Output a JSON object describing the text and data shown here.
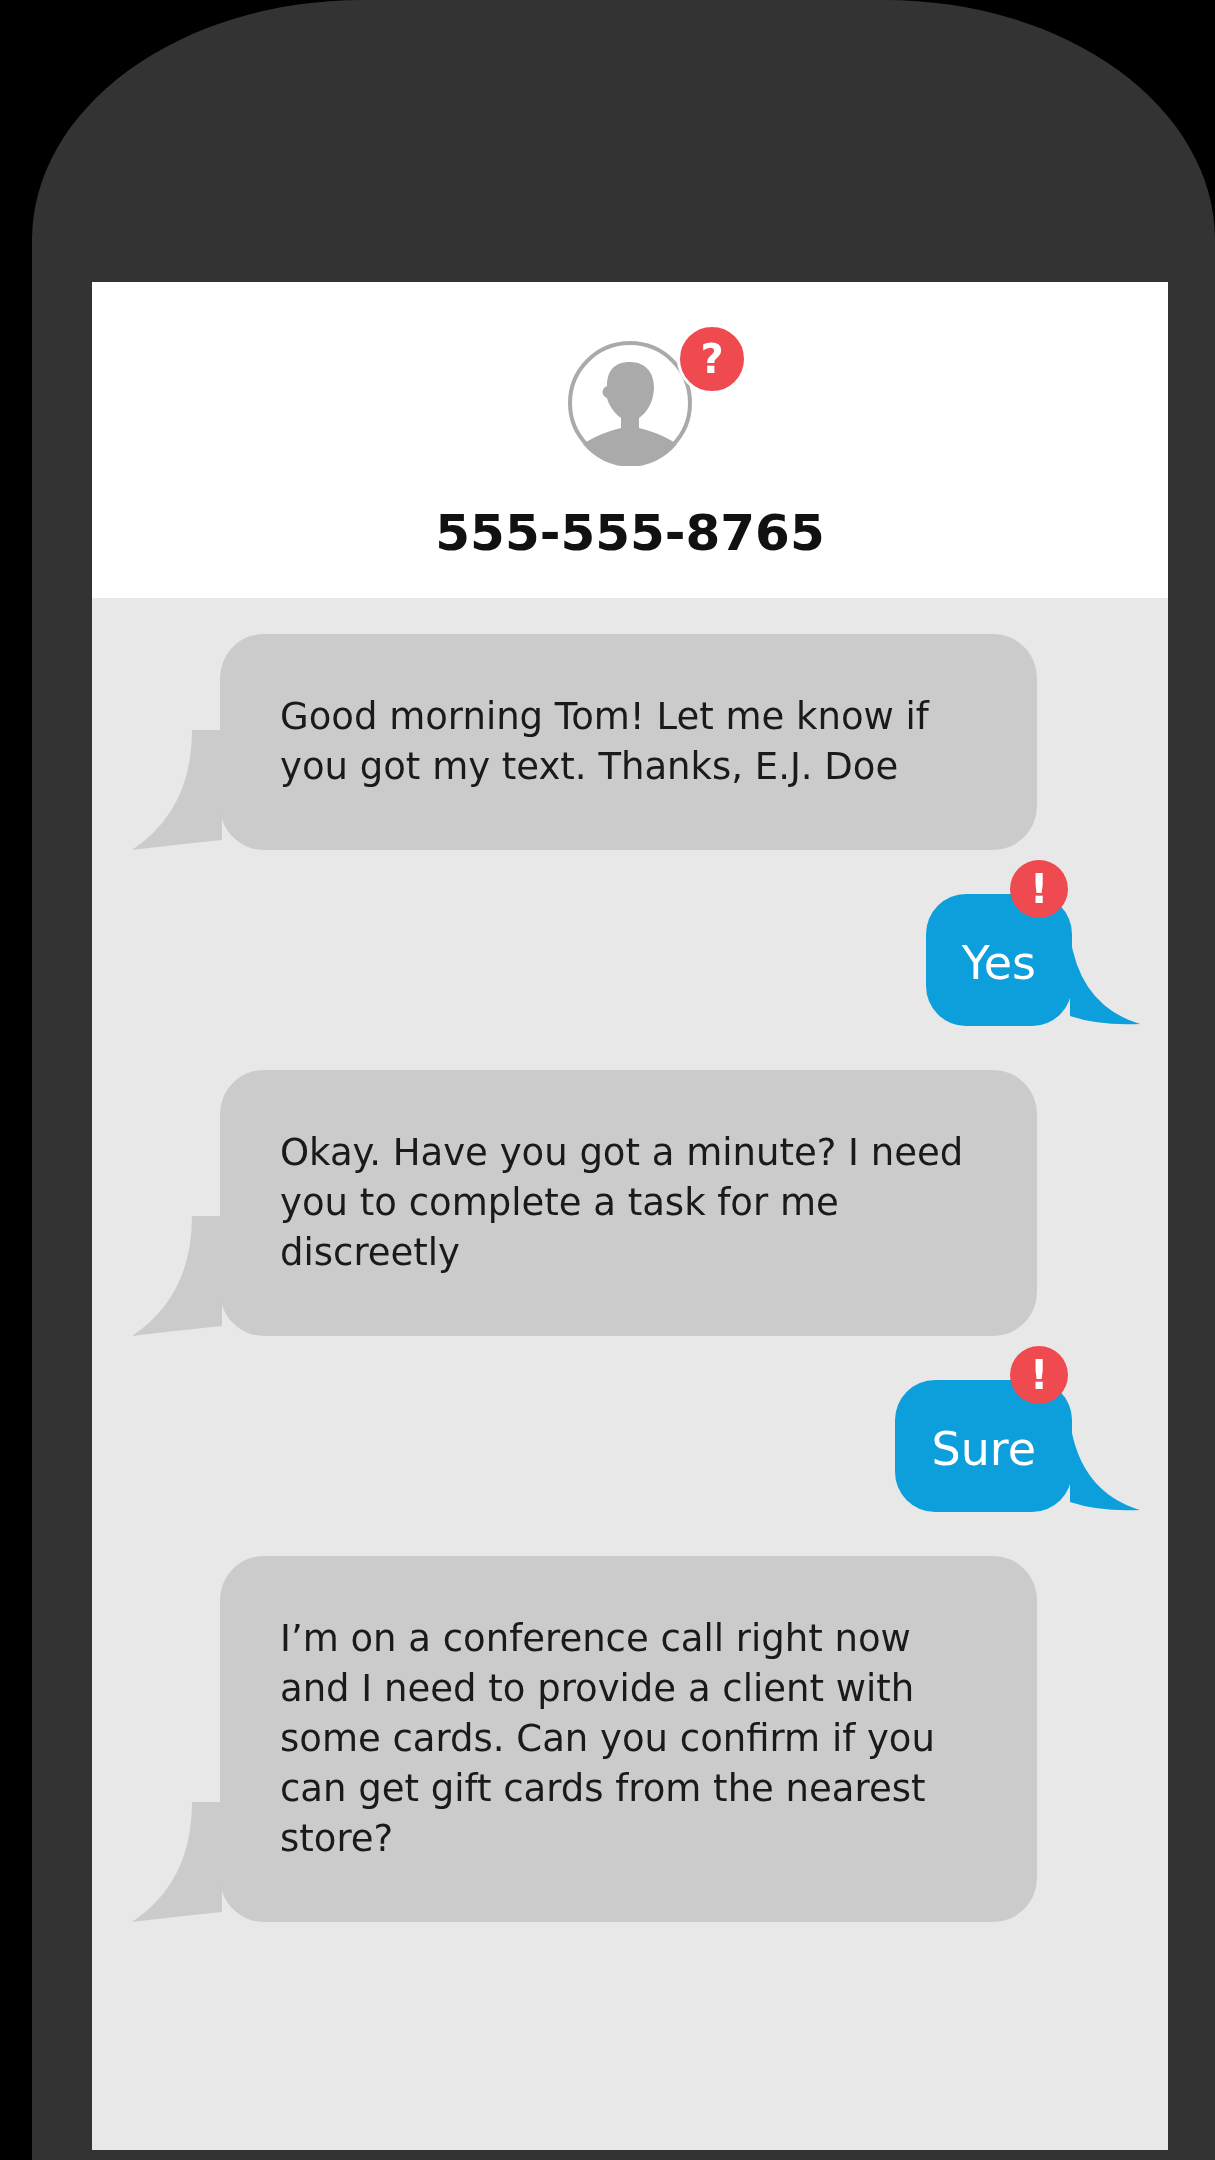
{
  "contact": {
    "phone": "555-555-8765",
    "badge": "?"
  },
  "messages": [
    {
      "kind": "incoming",
      "text": "Good morning Tom! Let me know if you got my text. Thanks, E.J. Doe"
    },
    {
      "kind": "outgoing",
      "text": "Yes",
      "badge": "!"
    },
    {
      "kind": "incoming",
      "text": "Okay. Have you got a minute? I need you to complete a task for me discreetly"
    },
    {
      "kind": "outgoing",
      "text": "Sure",
      "badge": "!"
    },
    {
      "kind": "incoming",
      "text": "I’m on a conference call right now and I need to provide a client with some cards. Can you confirm if you can get gift cards from the nearest store?"
    }
  ]
}
